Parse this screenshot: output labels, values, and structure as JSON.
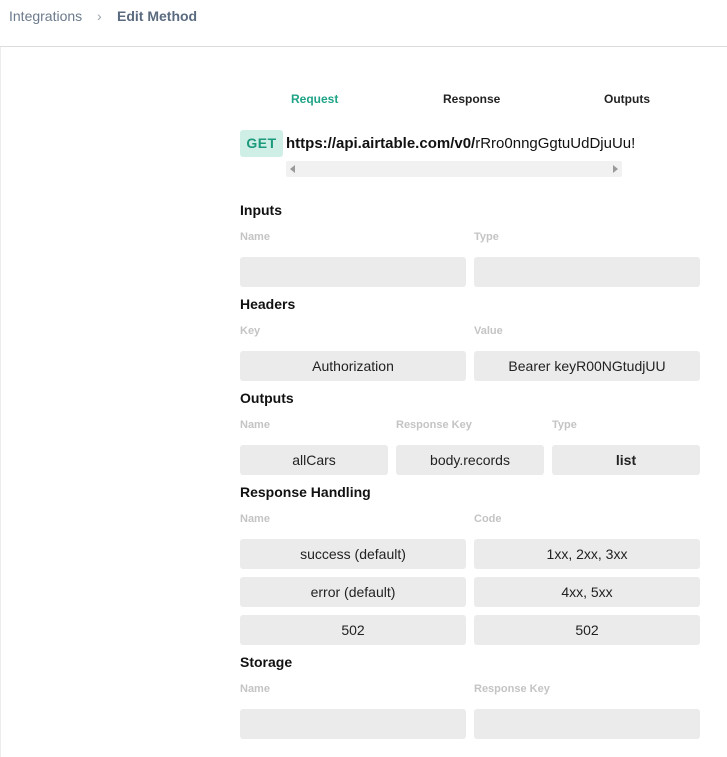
{
  "breadcrumb": {
    "parent": "Integrations",
    "separator": "›",
    "current": "Edit Method"
  },
  "tabs": [
    {
      "label": "Request",
      "active": true
    },
    {
      "label": "Response",
      "active": false
    },
    {
      "label": "Outputs",
      "active": false
    }
  ],
  "request": {
    "method": "GET",
    "url_base": "https://api.airtable.com/v0/",
    "url_rest": "rRro0nngGgtuUdDjuUu!"
  },
  "inputs": {
    "title": "Inputs",
    "col_name": "Name",
    "col_type": "Type",
    "row": {
      "name": "",
      "type": ""
    }
  },
  "headers": {
    "title": "Headers",
    "col_key": "Key",
    "col_value": "Value",
    "row": {
      "key": "Authorization",
      "value": "Bearer keyR00NGtudjUU"
    }
  },
  "outputs": {
    "title": "Outputs",
    "col_name": "Name",
    "col_response_key": "Response Key",
    "col_type": "Type",
    "row": {
      "name": "allCars",
      "response_key": "body.records",
      "type": "list"
    }
  },
  "response_handling": {
    "title": "Response Handling",
    "col_name": "Name",
    "col_code": "Code",
    "rows": [
      {
        "name": "success (default)",
        "code": "1xx, 2xx, 3xx"
      },
      {
        "name": "error (default)",
        "code": "4xx, 5xx"
      },
      {
        "name": "502",
        "code": "502"
      }
    ]
  },
  "storage": {
    "title": "Storage",
    "col_name": "Name",
    "col_response_key": "Response Key",
    "row": {
      "name": "",
      "response_key": ""
    }
  },
  "colors": {
    "accent": "#1fa386",
    "badge_bg": "#cfeee6",
    "field_bg": "#ebebeb",
    "label_muted": "#c4c4c4"
  }
}
